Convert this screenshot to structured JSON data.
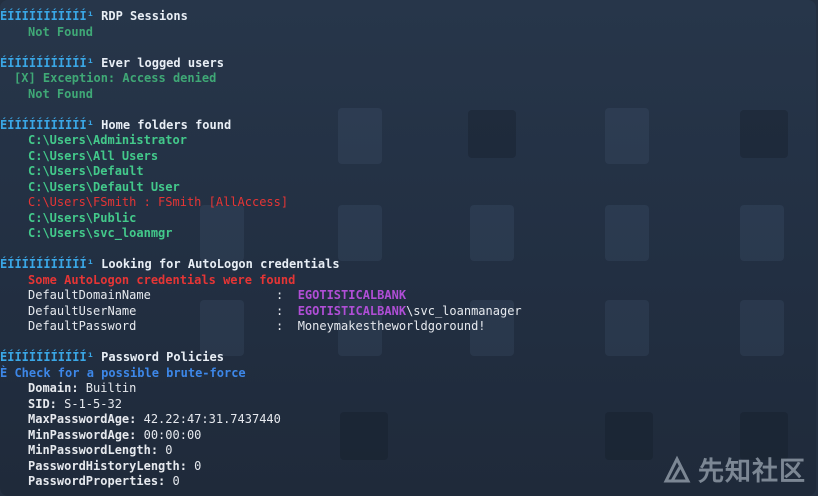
{
  "sections": {
    "rdp": {
      "bullet": "ÉÍÍÍÍÍÍÍÍÍÍÍ¹",
      "title": "RDP Sessions",
      "status": "Not Found"
    },
    "ever_logged": {
      "bullet": "ÉÍÍÍÍÍÍÍÍÍÍÍ¹",
      "title": "Ever logged users",
      "exception": "[X] Exception: Access denied",
      "status": "Not Found"
    },
    "home_folders": {
      "bullet": "ÉÍÍÍÍÍÍÍÍÍÍÍ¹",
      "title": "Home folders found",
      "items": [
        "C:\\Users\\Administrator",
        "C:\\Users\\All Users",
        "C:\\Users\\Default",
        "C:\\Users\\Default User"
      ],
      "highlight": "C:\\Users\\FSmith : FSmith [AllAccess]",
      "items_after": [
        "C:\\Users\\Public",
        "C:\\Users\\svc_loanmgr"
      ]
    },
    "autologon": {
      "bullet": "ÉÍÍÍÍÍÍÍÍÍÍÍ¹",
      "title": "Looking for AutoLogon credentials",
      "alert": "Some AutoLogon credentials were found",
      "rows": [
        {
          "key": "DefaultDomainName",
          "sep": ":",
          "value_highlight": "EGOTISTICALBANK",
          "value_rest": ""
        },
        {
          "key": "DefaultUserName",
          "sep": ":",
          "value_highlight": "EGOTISTICALBANK",
          "value_rest": "\\svc_loanmanager"
        },
        {
          "key": "DefaultPassword",
          "sep": ":",
          "value_highlight": "",
          "value_rest": "Moneymakestheworldgoround!"
        }
      ]
    },
    "password_policies": {
      "bullet": "ÉÍÍÍÍÍÍÍÍÍÍÍ¹",
      "title": "Password Policies",
      "hint": "È Check for a possible brute-force",
      "fields": [
        {
          "label": "Domain:",
          "value": " Builtin"
        },
        {
          "label": "SID:",
          "value": " S-1-5-32"
        },
        {
          "label": "MaxPasswordAge:",
          "value": " 42.22:47:31.7437440"
        },
        {
          "label": "MinPasswordAge:",
          "value": " 00:00:00"
        },
        {
          "label": "MinPasswordLength:",
          "value": " 0"
        },
        {
          "label": "PasswordHistoryLength:",
          "value": " 0"
        },
        {
          "label": "PasswordProperties:",
          "value": " 0"
        }
      ]
    }
  },
  "watermark": {
    "text": "先知社区",
    "icon": "xianzhi-logo-icon"
  },
  "colors": {
    "bullet": "#3aa7e6",
    "green": "#43c98b",
    "red": "#e53535",
    "blue": "#3d87e8",
    "purple": "#b04ed6",
    "background": "#243041"
  }
}
